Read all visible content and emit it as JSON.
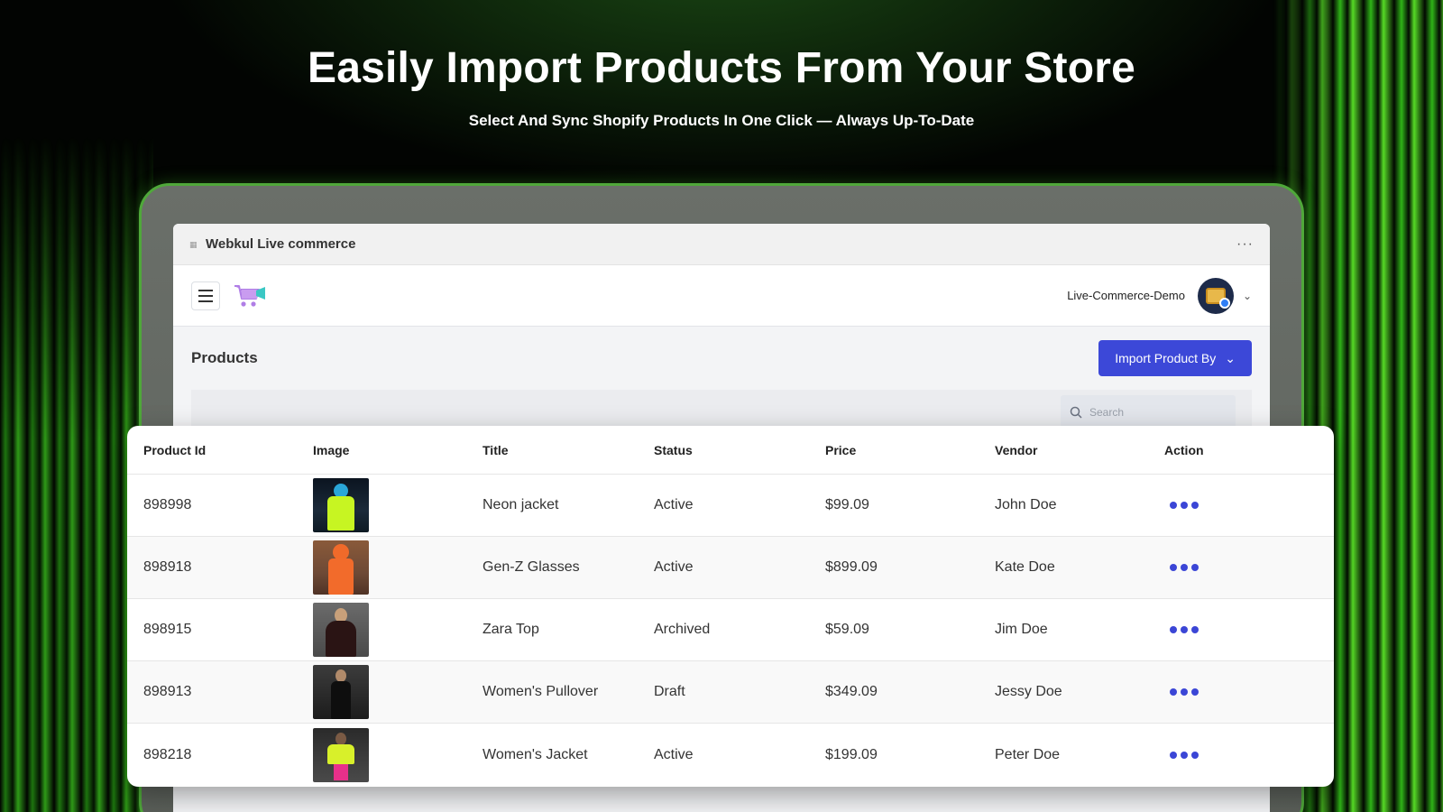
{
  "hero": {
    "title": "Easily Import Products From Your Store",
    "subtitle": "Select And Sync Shopify Products In One Click — Always Up-To-Date"
  },
  "window": {
    "title": "Webkul Live commerce",
    "more": "···"
  },
  "appbar": {
    "store_name": "Live-Commerce-Demo",
    "chevron": "⌄"
  },
  "products": {
    "title": "Products",
    "import_button": "Import Product By",
    "import_chevron": "⌄",
    "search_placeholder": "Search"
  },
  "table": {
    "columns": [
      "Product Id",
      "Image",
      "Title",
      "Status",
      "Price",
      "Vendor",
      "Action"
    ],
    "rows": [
      {
        "id": "898998",
        "title": "Neon jacket",
        "status": "Active",
        "price": "$99.09",
        "vendor": "John Doe"
      },
      {
        "id": "898918",
        "title": "Gen-Z Glasses",
        "status": "Active",
        "price": "$899.09",
        "vendor": "Kate Doe"
      },
      {
        "id": "898915",
        "title": "Zara Top",
        "status": "Archived",
        "price": "$59.09",
        "vendor": "Jim Doe"
      },
      {
        "id": "898913",
        "title": "Women's Pullover",
        "status": "Draft",
        "price": "$349.09",
        "vendor": "Jessy Doe"
      },
      {
        "id": "898218",
        "title": "Women's Jacket",
        "status": "Active",
        "price": "$199.09",
        "vendor": "Peter Doe"
      }
    ]
  },
  "colors": {
    "accent": "#3c48d8",
    "action_dots": "#3b46d6",
    "background_glow": "#2c7a1e",
    "device_border": "#4fa83a"
  }
}
